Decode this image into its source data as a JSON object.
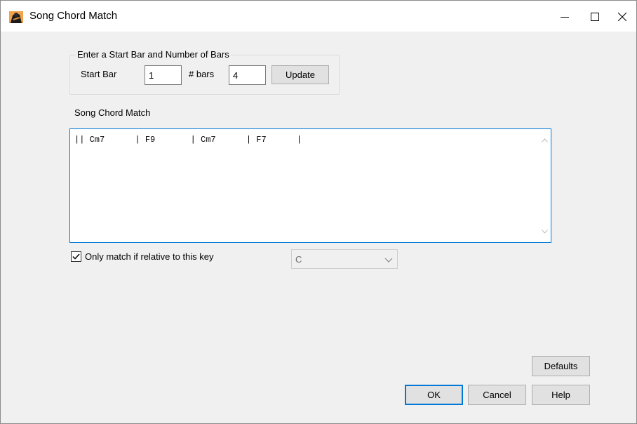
{
  "window": {
    "title": "Song Chord Match",
    "icon": "app-guitarist-icon",
    "controls": [
      "minimize-icon",
      "maximize-icon",
      "close-icon"
    ]
  },
  "range_group": {
    "legend": "Enter a Start Bar and Number of Bars",
    "start_bar_label": "Start Bar",
    "start_bar_value": "1",
    "bars_label": "# bars",
    "bars_value": "4",
    "update_label": "Update"
  },
  "chord_match": {
    "label": "Song Chord Match",
    "text": "|| Cm7      | F9       | Cm7      | F7      |"
  },
  "key_match": {
    "checkbox_label": "Only match if relative to this  key",
    "checked": true,
    "key_value": "C"
  },
  "buttons": {
    "defaults": "Defaults",
    "ok": "OK",
    "cancel": "Cancel",
    "help": "Help"
  },
  "colors": {
    "accent": "#0078d7",
    "dialog_bg": "#f0f0f0"
  }
}
